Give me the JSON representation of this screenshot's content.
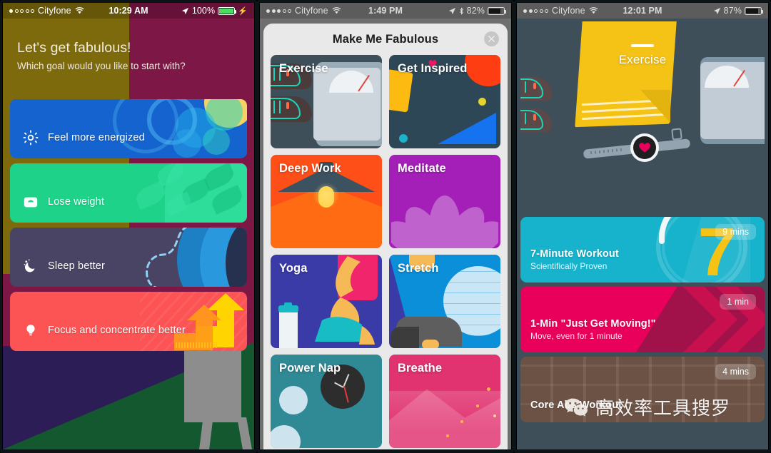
{
  "phones": [
    {
      "id": "phone-goals",
      "status": {
        "carrier": "Cityfone",
        "signal_filled": 1,
        "signal_total": 5,
        "wifi": "wifi-icon",
        "time": "10:29 AM",
        "location": "location-arrow-icon",
        "bluetooth": null,
        "battery_percent": "100%",
        "battery_level": 100,
        "charging": true,
        "text_color": "#ffffff",
        "battery_color": "#4cd964"
      },
      "title": "Let's get fabulous!",
      "subtitle": "Which goal would you like to start with?",
      "goals": [
        {
          "label": "Feel more energized",
          "icon": "sun-icon",
          "color": "#1563cf"
        },
        {
          "label": "Lose weight",
          "icon": "scale-icon",
          "color": "#1ed389"
        },
        {
          "label": "Sleep better",
          "icon": "moon-icon",
          "color": "#494464"
        },
        {
          "label": "Focus and concentrate better",
          "icon": "lightbulb-icon",
          "color": "#fc5354"
        }
      ]
    },
    {
      "id": "phone-catalog",
      "status": {
        "carrier": "Cityfone",
        "signal_filled": 3,
        "signal_total": 5,
        "wifi": "wifi-icon",
        "time": "1:49 PM",
        "location": "location-arrow-icon",
        "bluetooth": "bluetooth-icon",
        "battery_percent": "82%",
        "battery_level": 82,
        "charging": false,
        "text_color": "#dddddd",
        "battery_color": "#141414"
      },
      "sheet_title": "Make Me Fabulous",
      "close_label": "✕",
      "tiles": [
        {
          "label": "Exercise",
          "color": "#3e4f59",
          "art": "sneakers-scale"
        },
        {
          "label": "Get Inspired",
          "color": "#2d4756",
          "art": "abstract-shapes"
        },
        {
          "label": "Deep Work",
          "color": "#ff4f18",
          "art": "desk-lamp"
        },
        {
          "label": "Meditate",
          "color": "#a41fb8",
          "art": "lotus"
        },
        {
          "label": "Yoga",
          "color": "#3b3ba8",
          "art": "yoga-pose"
        },
        {
          "label": "Stretch",
          "color": "#3b3ba8",
          "art": "stretch-ball"
        },
        {
          "label": "Power Nap",
          "color": "#2f8a96",
          "art": "clock"
        },
        {
          "label": "Breathe",
          "color": "#e0336f",
          "art": "mountain-sparkles"
        }
      ]
    },
    {
      "id": "phone-exercise",
      "status": {
        "carrier": "Cityfone",
        "signal_filled": 2,
        "signal_total": 5,
        "wifi": "wifi-icon",
        "time": "12:01 PM",
        "location": "location-arrow-icon",
        "bluetooth": null,
        "battery_percent": "87%",
        "battery_level": 87,
        "charging": false,
        "text_color": "#dddddd",
        "battery_color": "#141414"
      },
      "hero_title": "Exercise",
      "workouts": [
        {
          "title": "7-Minute Workout",
          "subtitle": "Scientifically Proven",
          "duration": "9 mins",
          "color": "#17b3cc"
        },
        {
          "title": "1-Min \"Just Get Moving!\"",
          "subtitle": "Move, even for 1 minute",
          "duration": "1 min",
          "color": "#e8005a"
        },
        {
          "title": "Core Abs Workout",
          "subtitle": "",
          "duration": "4 mins",
          "color": "#7a5c4e"
        }
      ]
    }
  ],
  "watermark": {
    "icon": "wechat-icon",
    "text": "高效率工具搜罗"
  }
}
